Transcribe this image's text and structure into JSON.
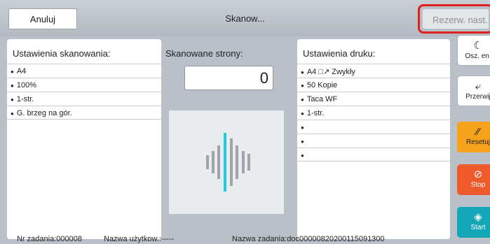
{
  "header": {
    "cancel_label": "Anuluj",
    "title": "Skanow...",
    "reserve_label": "Rezerw. nast."
  },
  "scan_settings": {
    "title": "Ustawienia skanowania:",
    "items": [
      "A4",
      "100%",
      "1-str.",
      "G. brzeg na gór."
    ]
  },
  "scanned_pages": {
    "title": "Skanowane strony:",
    "count": "0"
  },
  "print_settings": {
    "title": "Ustawienia druku:",
    "items": [
      "A4 □↗ Zwykły",
      "50    Kopie",
      "Taca WF",
      "1-str.",
      "",
      "",
      ""
    ]
  },
  "side_buttons": {
    "sleep_label": "Osz. en.",
    "interrupt_label": "Przerwij",
    "reset_label": "Resetuj",
    "stop_label": "Stop",
    "start_label": "Start"
  },
  "footer": {
    "job_no": "Nr zadania:000008",
    "user_name": "Nazwa użytkow.:-----",
    "job_name": "Nazwa zadania:doc00000820200115091300"
  },
  "colors": {
    "highlight": "#e01f1f",
    "reset": "#f7a21b",
    "stop": "#ef5a2d",
    "start": "#12a6b6",
    "active_bar": "#1ccbe6"
  }
}
